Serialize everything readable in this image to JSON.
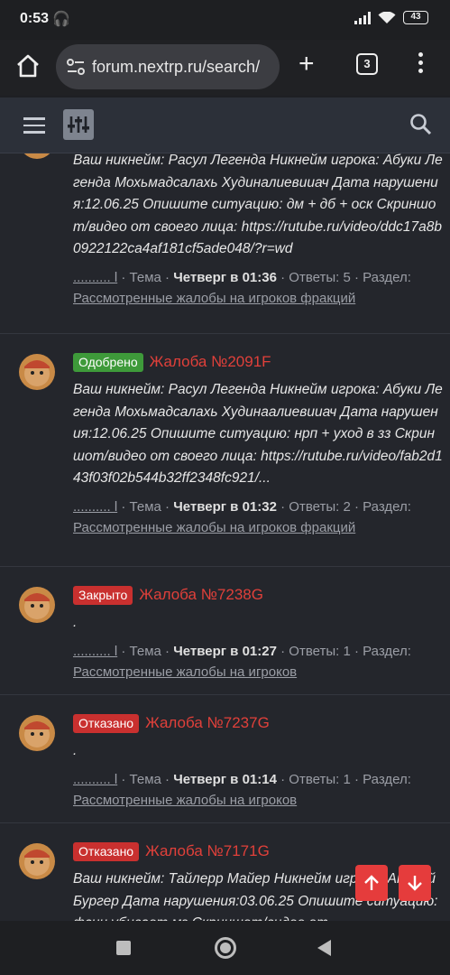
{
  "status_bar": {
    "time": "0:53",
    "headset": "🎧",
    "battery": "43"
  },
  "browser": {
    "url": "forum.nextrp.ru/search/",
    "tab_count": "3"
  },
  "threads": [
    {
      "status": "",
      "title": "",
      "snippet": "Ваш никнейм: Расул Легенда Никнейм игрока: Абуки Легенда Мохьмадсалахь Худиналиевииач Дата нарушения:12.06.25 Опишите ситуацию: дм + дб + оск Скриншот/видео от своего лица: https://rutube.ru/video/ddc17a8b0922122ca4af181cf5ade048/?r=wd",
      "author": ".......... l",
      "type": "Тема",
      "date": "Четверг в 01:36",
      "replies": "Ответы: 5",
      "section_label": "Раздел:",
      "forum": "Рассмотренные жалобы на игроков фракций"
    },
    {
      "status": "Одобрено",
      "title": "Жалоба №2091F",
      "snippet": "Ваш никнейм: Расул Легенда Никнейм игрока: Абуки Легенда Мохьмадсалахь Худинаалиевииач Дата нарушения:12.06.25 Опишите ситуацию: нрп + уход в зз Скриншот/видео от своего лица: https://rutube.ru/video/fab2d143f03f02b544b32ff2348fc921/...",
      "author": ".......... l",
      "type": "Тема",
      "date": "Четверг в 01:32",
      "replies": "Ответы: 2",
      "section_label": "Раздел:",
      "forum": "Рассмотренные жалобы на игроков фракций"
    },
    {
      "status": "Закрыто",
      "title": "Жалоба №7238G",
      "snippet": ".",
      "author": ".......... l",
      "type": "Тема",
      "date": "Четверг в 01:27",
      "replies": "Ответы: 1",
      "section_label": "Раздел:",
      "forum": "Рассмотренные жалобы на игроков"
    },
    {
      "status": "Отказано",
      "title": "Жалоба №7237G",
      "snippet": ".",
      "author": ".......... l",
      "type": "Тема",
      "date": "Четверг в 01:14",
      "replies": "Ответы: 1",
      "section_label": "Раздел:",
      "forum": "Рассмотренные жалобы на игроков"
    },
    {
      "status": "Отказано",
      "title": "Жалоба №7171G",
      "snippet": "Ваш никнейм: Тайлерр Майер Никнейм игрока: Андрей Бургер Дата нарушения:03.06.25 Опишите ситуацию: фсин убивает мз Скриншот/видео от",
      "author": "",
      "type": "",
      "date": "",
      "replies": "",
      "section_label": "",
      "forum": ""
    }
  ],
  "colors": {
    "approved": "#3e9a3a",
    "closed": "#c9302f",
    "title": "#e0403a"
  },
  "icons": [
    "home-icon",
    "tune-icon",
    "plus-icon",
    "tabs-icon",
    "menu-icon",
    "hamburger-icon",
    "filter-icon",
    "search-icon",
    "arrow-up-icon",
    "arrow-down-icon"
  ]
}
